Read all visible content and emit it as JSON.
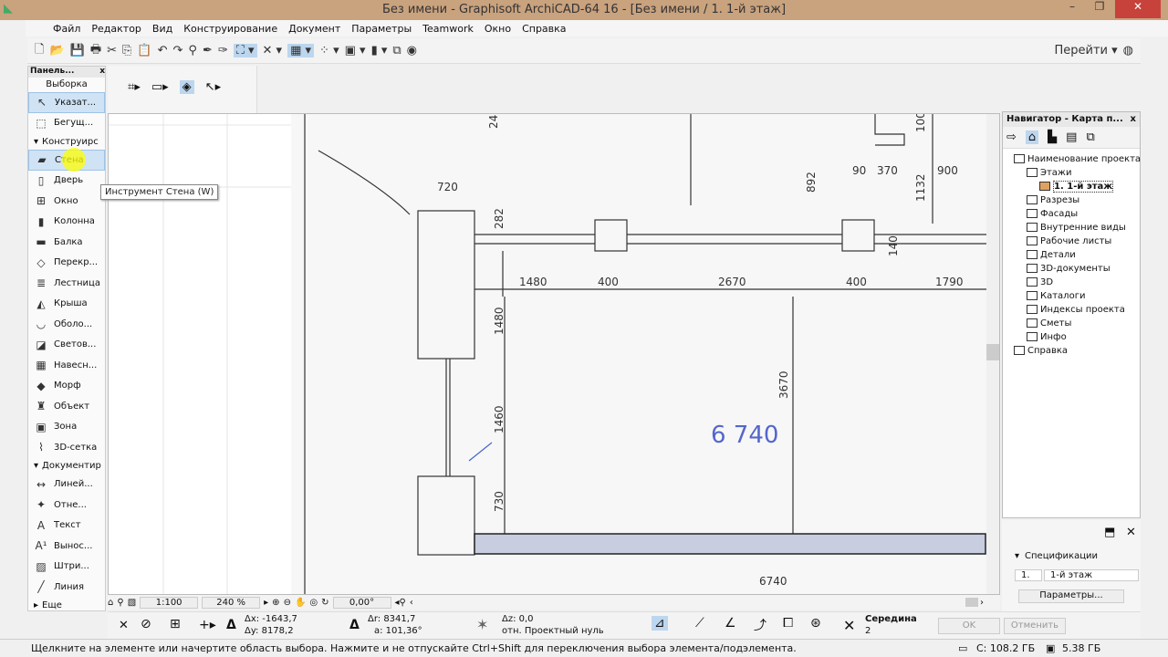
{
  "window": {
    "title": "Без имени - Graphisoft ArchiCAD-64 16 - [Без имени / 1. 1-й этаж]",
    "min": "–",
    "max": "❐",
    "close": "✕"
  },
  "menu": [
    "Файл",
    "Редактор",
    "Вид",
    "Конструирование",
    "Документ",
    "Параметры",
    "Teamwork",
    "Окно",
    "Справка"
  ],
  "toolbar": {
    "goto_label": "Перейти"
  },
  "toolbox": {
    "title": "Панель...",
    "select_header": "Выборка",
    "select_items": [
      {
        "label": "Указат...",
        "icon": "arrow-icon"
      },
      {
        "label": "Бегущ...",
        "icon": "marquee-icon"
      }
    ],
    "construct_header": "Конструирс",
    "construct_items": [
      {
        "label": "Стена",
        "icon": "wall-icon"
      },
      {
        "label": "Дверь",
        "icon": "door-icon"
      },
      {
        "label": "Окно",
        "icon": "window-icon"
      },
      {
        "label": "Колонна",
        "icon": "column-icon"
      },
      {
        "label": "Балка",
        "icon": "beam-icon"
      },
      {
        "label": "Перекр...",
        "icon": "slab-icon"
      },
      {
        "label": "Лестница",
        "icon": "stair-icon"
      },
      {
        "label": "Крыша",
        "icon": "roof-icon"
      },
      {
        "label": "Оболо...",
        "icon": "shell-icon"
      },
      {
        "label": "Светов...",
        "icon": "skylight-icon"
      },
      {
        "label": "Навесн...",
        "icon": "curtain-wall-icon"
      },
      {
        "label": "Морф",
        "icon": "morph-icon"
      },
      {
        "label": "Объект",
        "icon": "object-icon"
      },
      {
        "label": "Зона",
        "icon": "zone-icon"
      },
      {
        "label": "3D-сетка",
        "icon": "mesh-icon"
      }
    ],
    "document_header": "Документир",
    "document_items": [
      {
        "label": "Линей...",
        "icon": "dimension-icon"
      },
      {
        "label": "Отне...",
        "icon": "level-dimension-icon"
      },
      {
        "label": "Текст",
        "icon": "text-icon"
      },
      {
        "label": "Вынос...",
        "icon": "label-icon"
      },
      {
        "label": "Штри...",
        "icon": "fill-icon"
      },
      {
        "label": "Линия",
        "icon": "line-icon"
      }
    ],
    "more": "Еще"
  },
  "tooltip": "Инструмент Стена (W)",
  "drawing": {
    "dims": [
      "720",
      "282",
      "1480",
      "400",
      "2670",
      "400",
      "1790",
      "1480",
      "1460",
      "730",
      "3670",
      "892",
      "1132",
      "90",
      "370",
      "900",
      "100",
      "140",
      "6740",
      "24"
    ],
    "level": "6 740"
  },
  "navigator": {
    "title": "Навигатор - Карта п...",
    "close": "x",
    "tree": [
      {
        "label": "Наименование проекта",
        "level": 0
      },
      {
        "label": "Этажи",
        "level": 1
      },
      {
        "label": "1. 1-й этаж",
        "level": 2,
        "selected": true
      },
      {
        "label": "Разрезы",
        "level": 1
      },
      {
        "label": "Фасады",
        "level": 1
      },
      {
        "label": "Внутренние виды",
        "level": 1
      },
      {
        "label": "Рабочие листы",
        "level": 1
      },
      {
        "label": "Детали",
        "level": 1
      },
      {
        "label": "3D-документы",
        "level": 1
      },
      {
        "label": "3D",
        "level": 1
      },
      {
        "label": "Каталоги",
        "level": 1
      },
      {
        "label": "Индексы проекта",
        "level": 1
      },
      {
        "label": "Сметы",
        "level": 1
      },
      {
        "label": "Инфо",
        "level": 1
      },
      {
        "label": "Справка",
        "level": 0
      }
    ],
    "spec_label": "Спецификации",
    "num": "1.",
    "name": "1-й этаж",
    "params_button": "Параметры..."
  },
  "viewbar": {
    "scale": "1:100",
    "zoom": "240 %",
    "angle": "0,00°"
  },
  "coords": {
    "dx": "Δx: -1643,7",
    "dy": "Δy: 8178,2",
    "dr": "Δr: 8341,7",
    "da": "a: 101,36°",
    "dz": "Δz: 0,0",
    "ref": "отн. Проектный нуль",
    "snap": "Середина",
    "snap_n": "2",
    "ok": "OK",
    "cancel": "Отменить"
  },
  "status": {
    "text": "Щелкните на элементе или начертите область выбора. Нажмите и не отпускайте Ctrl+Shift для переключения выбора элемента/подэлемента.",
    "disk": "C: 108.2 ГБ",
    "ram": "5.38 ГБ"
  },
  "colors": {
    "title_bar": "#c9a27e",
    "selection": "#cfe3f5",
    "level_text": "#5566cc",
    "wall_fill": "#c8cde0"
  }
}
